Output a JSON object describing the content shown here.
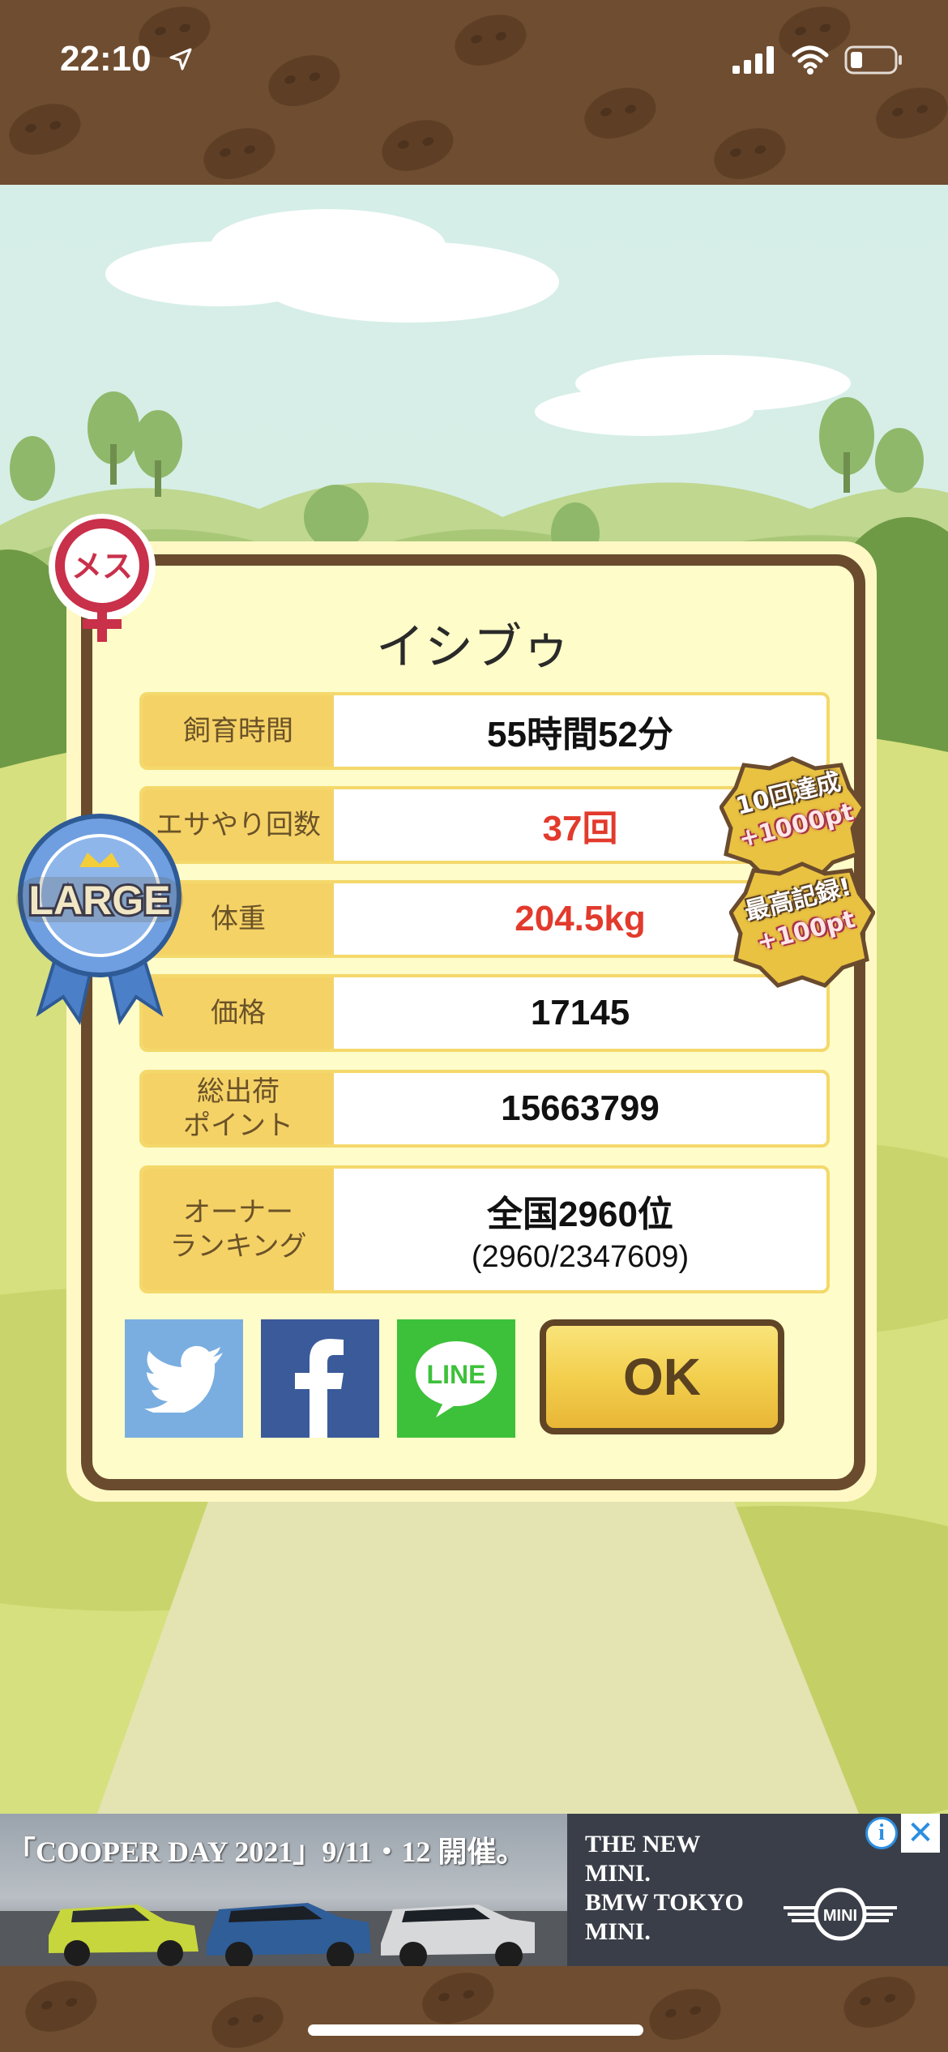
{
  "status_bar": {
    "time": "22:10",
    "icons": [
      "location-arrow-icon",
      "signal-icon",
      "wifi-icon",
      "battery-icon"
    ]
  },
  "badges": {
    "gender": "メス",
    "size": "LARGE",
    "achievement_1": {
      "line1": "10回達成",
      "line2": "+1000pt"
    },
    "achievement_2": {
      "line1": "最高記録!",
      "line2": "+100pt"
    }
  },
  "dialog": {
    "name": "イシブゥ",
    "rows": [
      {
        "label": "飼育時間",
        "value": "55時間52分",
        "highlight": false
      },
      {
        "label": "エサやり回数",
        "value": "37回",
        "highlight": true
      },
      {
        "label": "体重",
        "value": "204.5kg",
        "highlight": true
      },
      {
        "label": "価格",
        "value": "17145",
        "highlight": false
      },
      {
        "label": "総出荷\nポイント",
        "value": "15663799",
        "highlight": false
      },
      {
        "label": "オーナー\nランキング",
        "value": "全国2960位",
        "sub": "(2960/2347609)",
        "highlight": false
      }
    ],
    "share": {
      "twitter": "twitter-icon",
      "facebook": "facebook-icon",
      "line": "LINE"
    },
    "ok_label": "OK"
  },
  "ad": {
    "title": "「COOPER DAY 2021」9/11・12 開催。",
    "copy": "THE NEW\nMINI.\nBMW TOKYO\nMINI.",
    "brand": "MINI",
    "info": "i",
    "close": "✕"
  },
  "colors": {
    "brown": "#6a4b2e",
    "label_bg": "#f5d266",
    "highlight": "#e23a2c",
    "twitter": "#7aaee0",
    "facebook": "#3b5a9a",
    "line": "#3dc13a"
  }
}
